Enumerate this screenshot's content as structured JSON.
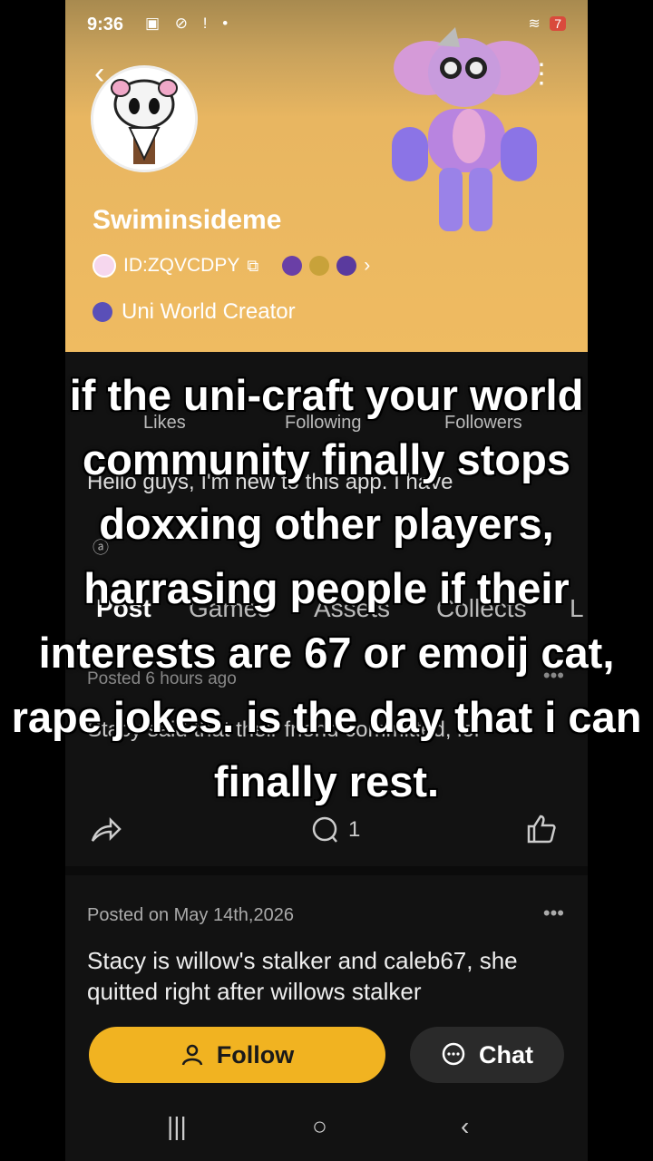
{
  "status": {
    "time": "9:36",
    "battery": "7"
  },
  "profile": {
    "username": "Swiminsideme",
    "id_text": "ID:ZQVCDPY",
    "title": "Uni World Creator",
    "bio": "Hello guys, I'm new to this app. I have"
  },
  "stats": {
    "likes_label": "Likes",
    "following_label": "Following",
    "followers_label": "Followers"
  },
  "tabs": [
    "Post",
    "Games",
    "Assets",
    "Collects",
    "L"
  ],
  "post1": {
    "posted": "Posted 6 hours ago",
    "text": "Stacy said that their friend committed, lol",
    "comments": "1"
  },
  "post2": {
    "posted": "Posted on May 14th,2026",
    "text": "Stacy is willow's stalker and caleb67, she quitted right after willows stalker"
  },
  "buttons": {
    "follow": "Follow",
    "chat": "Chat"
  },
  "overlay_caption": "if the uni-craft your world community finally stops doxxing other players, harrasing people if their interests are 67 or emoij cat, rape jokes. is the day that i can finally rest.",
  "colors": {
    "banner": "#efbb61",
    "follow_button": "#f1b321",
    "background": "#121212"
  }
}
